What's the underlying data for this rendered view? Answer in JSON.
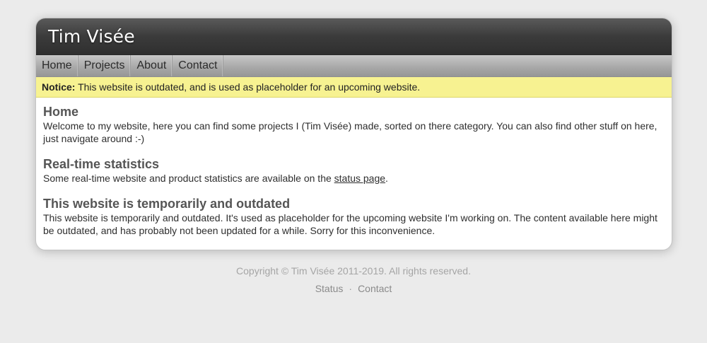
{
  "header": {
    "title": "Tim Visée"
  },
  "nav": {
    "items": [
      {
        "label": "Home"
      },
      {
        "label": "Projects"
      },
      {
        "label": "About"
      },
      {
        "label": "Contact"
      }
    ]
  },
  "notice": {
    "label": "Notice:",
    "text": " This website is outdated, and is used as placeholder for an upcoming website."
  },
  "sections": [
    {
      "heading": "Home",
      "text": "Welcome to my website, here you can find some projects I (Tim Visée) made, sorted on there category. You can also find other stuff on here, just navigate around :-)"
    },
    {
      "heading": "Real-time statistics",
      "text_before": "Some real-time website and product statistics are available on the ",
      "link": "status page",
      "text_after": "."
    },
    {
      "heading": "This website is temporarily and outdated",
      "text": "This website is temporarily and outdated. It's used as placeholder for the upcoming website I'm working on. The content available here might be outdated, and has probably not been updated for a while. Sorry for this inconvenience."
    }
  ],
  "footer": {
    "copyright": "Copyright © Tim Visée 2011-2019. All rights reserved.",
    "links": [
      {
        "label": "Status"
      },
      {
        "label": "Contact"
      }
    ],
    "separator": "·"
  },
  "colors": {
    "page_background": "#ebebeb",
    "header_dark": "#3b3b3b",
    "notice_background": "#f7f291",
    "heading_gray": "#555555"
  }
}
